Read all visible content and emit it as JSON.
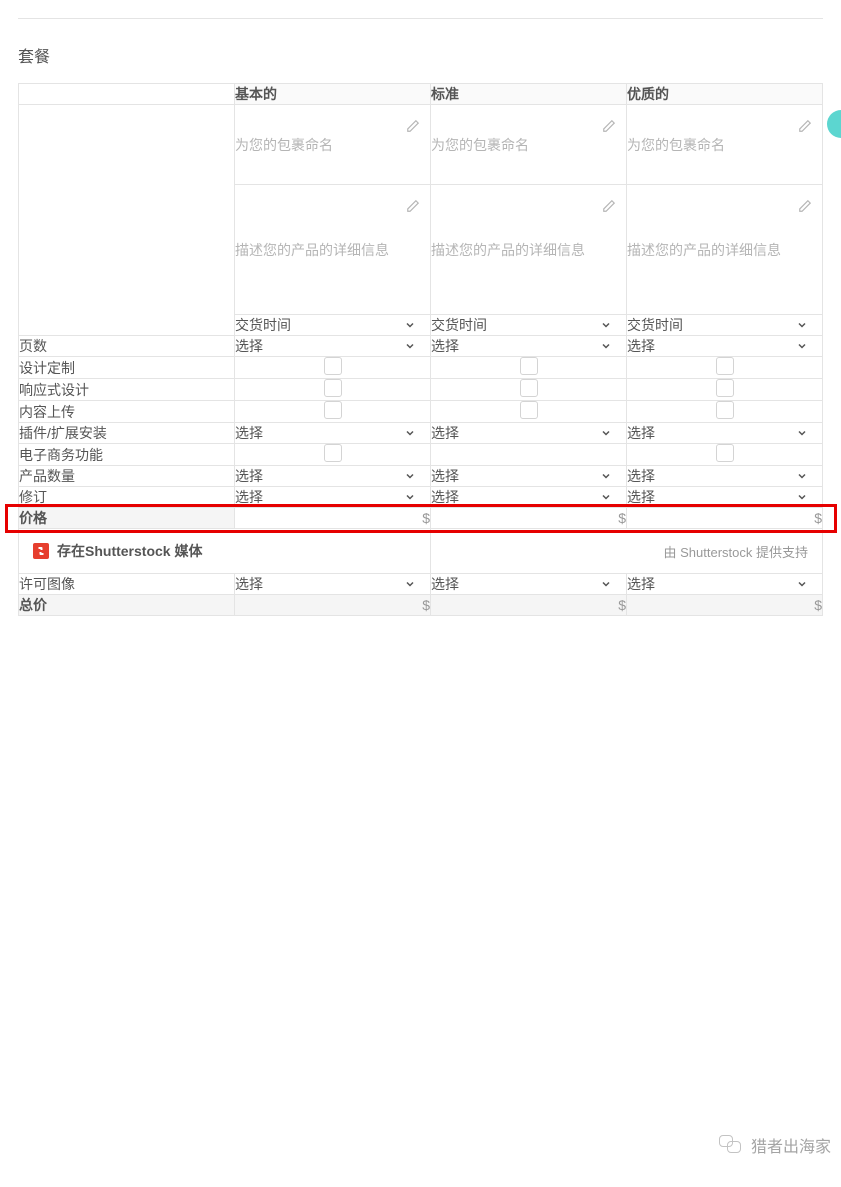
{
  "section_title": "套餐",
  "tiers": {
    "basic": "基本的",
    "standard": "标准",
    "premium": "优质的"
  },
  "placeholders": {
    "package_name": "为您的包裹命名",
    "package_desc": "描述您的产品的详细信息",
    "delivery_time": "交货时间",
    "select": "选择",
    "price_symbol": "$"
  },
  "rows": {
    "pages": "页数",
    "design_custom": "设计定制",
    "responsive": "响应式设计",
    "content_upload": "内容上传",
    "plugins": "插件/扩展安装",
    "ecommerce": "电子商务功能",
    "product_qty": "产品数量",
    "revisions": "修订",
    "price": "价格",
    "license_images": "许可图像",
    "total": "总价"
  },
  "shutterstock": {
    "title": "存在Shutterstock 媒体",
    "credit": "由 Shutterstock 提供支持"
  },
  "watermark": "猎者出海家"
}
